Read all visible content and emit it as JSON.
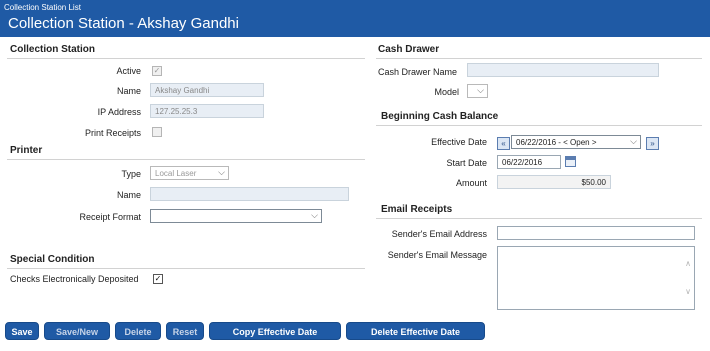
{
  "header": {
    "breadcrumb": "Collection Station List",
    "title": "Collection Station - Akshay Gandhi"
  },
  "collection_station": {
    "heading": "Collection Station",
    "active_label": "Active",
    "active_checked": true,
    "name_label": "Name",
    "name_value": "Akshay Gandhi",
    "ip_label": "IP Address",
    "ip_value": "127.25.25.3",
    "print_receipts_label": "Print Receipts",
    "print_receipts_checked": false
  },
  "printer": {
    "heading": "Printer",
    "type_label": "Type",
    "type_value": "Local Laser",
    "name_label": "Name",
    "name_value": "",
    "receipt_format_label": "Receipt Format",
    "receipt_format_value": ""
  },
  "special_condition": {
    "heading": "Special Condition",
    "checks_label": "Checks Electronically Deposited",
    "checks_checked": true
  },
  "cash_drawer": {
    "heading": "Cash Drawer",
    "name_label": "Cash Drawer Name",
    "name_value": "",
    "model_label": "Model",
    "model_value": ""
  },
  "beginning_cash_balance": {
    "heading": "Beginning Cash Balance",
    "effective_date_label": "Effective Date",
    "effective_date_value": "06/22/2016 - < Open >",
    "start_date_label": "Start Date",
    "start_date_value": "06/22/2016",
    "amount_label": "Amount",
    "amount_value": "$50.00"
  },
  "email_receipts": {
    "heading": "Email Receipts",
    "sender_email_label": "Sender's Email Address",
    "sender_email_value": "",
    "sender_message_label": "Sender's Email Message",
    "sender_message_value": ""
  },
  "icons": {
    "check": "✓",
    "chevron_down": "⌵",
    "prev": "«",
    "next": "»",
    "scroll_up": "∧",
    "scroll_down": "∨"
  },
  "buttons": {
    "save": "Save",
    "save_new": "Save/New",
    "delete": "Delete",
    "reset": "Reset",
    "copy_effective_date": "Copy Effective Date",
    "delete_effective_date": "Delete Effective Date"
  }
}
